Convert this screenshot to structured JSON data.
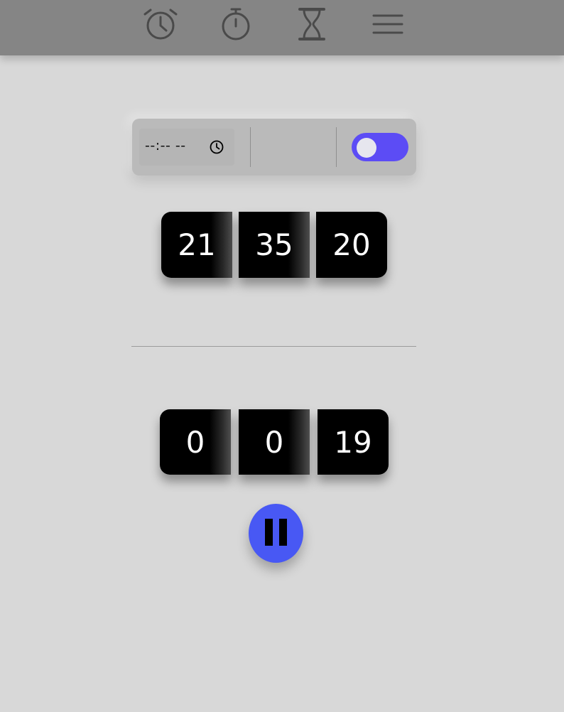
{
  "nav": {
    "items": [
      {
        "name": "alarm",
        "icon": "alarm-clock-icon"
      },
      {
        "name": "stopwatch",
        "icon": "stopwatch-icon"
      },
      {
        "name": "timer",
        "icon": "hourglass-icon"
      },
      {
        "name": "menu",
        "icon": "hamburger-menu-icon"
      }
    ]
  },
  "alarm": {
    "time_value": "--:-- --",
    "time_icon": "clock-icon",
    "enabled": true,
    "toggle_color": "#5c4cf5"
  },
  "clock": {
    "hours": "21",
    "minutes": "35",
    "seconds": "20"
  },
  "stopwatch": {
    "hours": "0",
    "minutes": "0",
    "seconds": "19",
    "control_icon": "pause-icon",
    "control_color": "#4858f4"
  },
  "colors": {
    "background": "#d8d8d8",
    "topbar": "#858585",
    "digit_bg": "#000000",
    "digit_text": "#ffffff"
  }
}
